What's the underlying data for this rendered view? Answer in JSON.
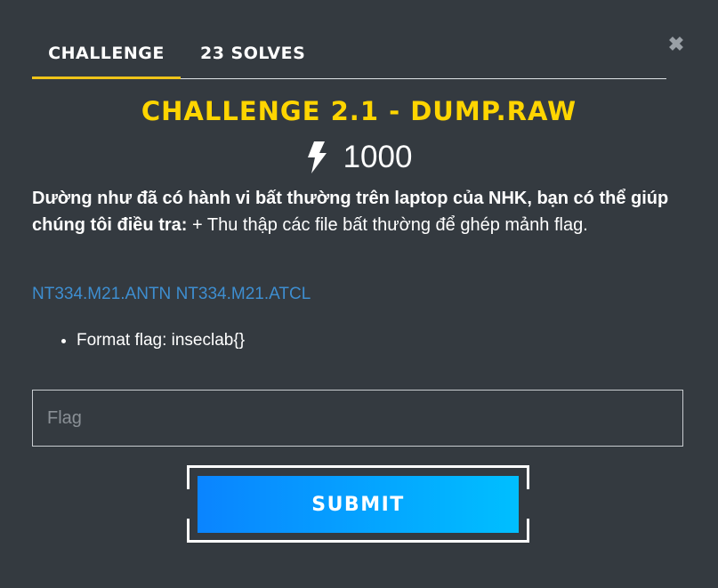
{
  "modal": {
    "close_icon": "close-icon",
    "tabs": [
      {
        "label": "CHALLENGE",
        "active": true
      },
      {
        "label": "23 SOLVES",
        "active": false
      }
    ],
    "colors": {
      "background": "#343a40",
      "title": "#ffd500",
      "tab_underline": "#f0c419",
      "link": "#3e8ed0",
      "button_gradient_start": "#0a84ff",
      "button_gradient_end": "#00bfff"
    }
  },
  "challenge": {
    "title": "CHALLENGE 2.1 - DUMP.RAW",
    "value_icon": "bolt-icon",
    "value": "1000",
    "description_bold": "Dường như đã có hành vi bất thường trên laptop của NHK, bạn có thể giúp chúng tôi điều tra:",
    "description_rest": " + Thu thập các file bất thường để ghép mảnh flag.",
    "links": [
      {
        "label": "NT334.M21.ANTN"
      },
      {
        "label": "NT334.M21.ATCL"
      }
    ],
    "bullets": [
      "Format flag: inseclab{}"
    ]
  },
  "form": {
    "flag_placeholder": "Flag",
    "flag_value": "",
    "submit_label": "SUBMIT"
  }
}
